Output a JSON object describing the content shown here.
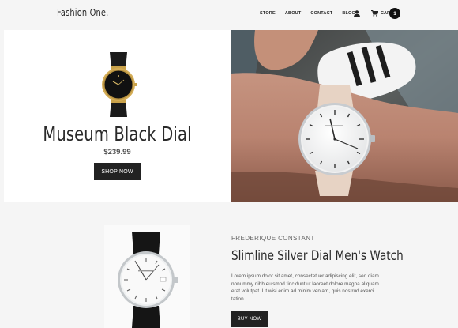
{
  "header": {
    "logo": "Fashion One.",
    "nav": [
      "STORE",
      "ABOUT",
      "CONTACT",
      "BLOG"
    ],
    "cart_label": "CART",
    "cart_count": "1",
    "icons": [
      "user-icon",
      "cart-icon"
    ]
  },
  "hero": {
    "title": "Museum Black Dial",
    "price": "$239.99",
    "button": "SHOP NOW"
  },
  "product": {
    "brand": "FREDERIQUE CONSTANT",
    "title": "Slimline Silver Dial Men's Watch",
    "description": "Lorem ipsum dolor sit amet, consectetuer adipiscing elit, sed diam nonummy nibh euismod tincidunt ut laoreet dolore magna aliquam erat volutpat. Ut wisi enim ad minim veniam, quis nostrud exerci tation.",
    "button": "BUY NOW"
  },
  "colors": {
    "dark": "#222222",
    "background": "#f5f5f5"
  }
}
